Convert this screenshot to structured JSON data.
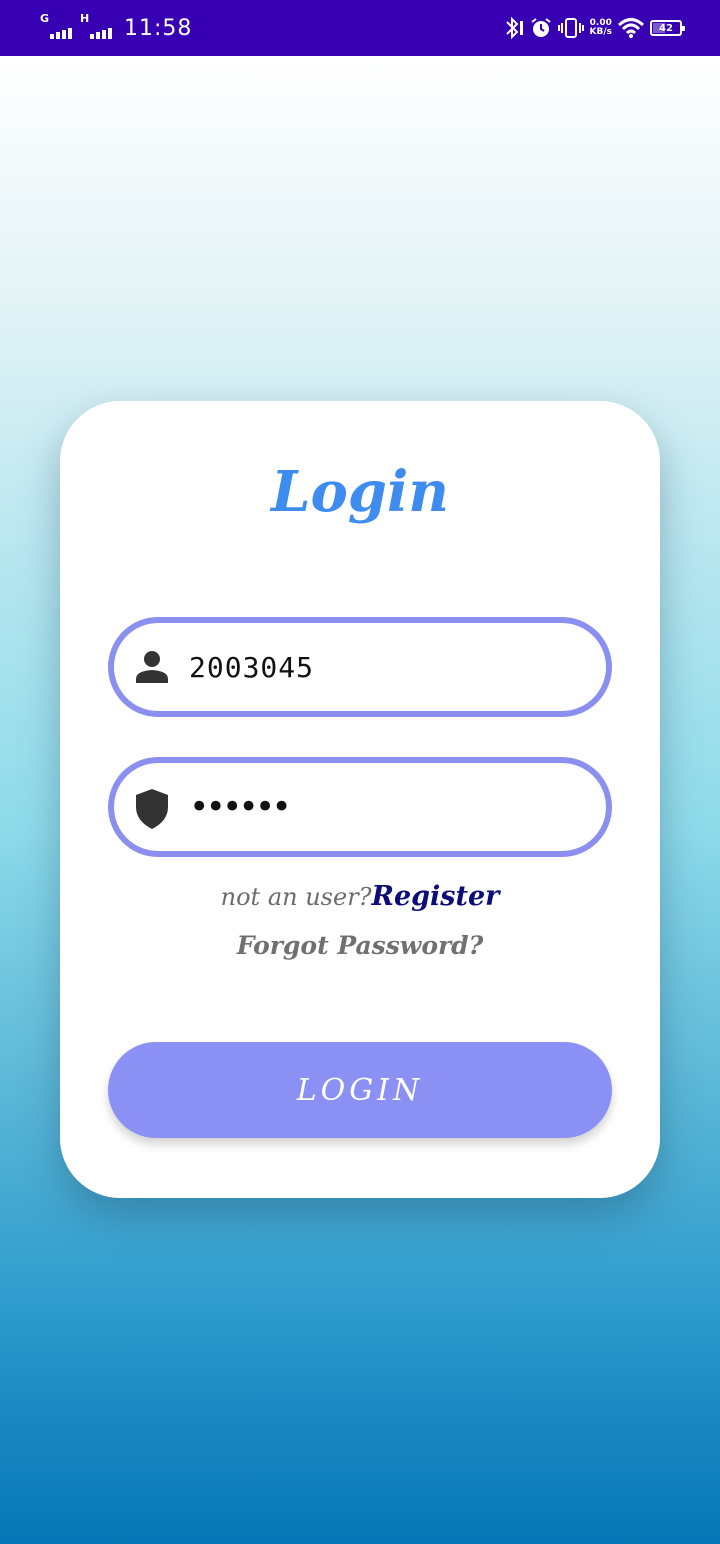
{
  "status_bar": {
    "sim1_label": "G",
    "sim2_label": "H",
    "time": "11:58",
    "net_speed_value": "0.00",
    "net_speed_unit": "KB/s",
    "battery_level": "42",
    "icons": [
      "bluetooth-icon",
      "alarm-icon",
      "vibrate-icon",
      "wifi-icon",
      "battery-icon"
    ]
  },
  "login_card": {
    "title": "Login",
    "username": {
      "value": "2003045",
      "icon": "person-icon"
    },
    "password": {
      "value": "aaaaaa",
      "icon": "shield-icon"
    },
    "prompt_text": "not an user?",
    "register_link": "Register",
    "forgot_link": "Forgot Password?",
    "login_button": "LOGIN"
  },
  "colors": {
    "status_bar": "#3700b3",
    "title": "#3f8cf0",
    "field_border": "#8a8ff0",
    "button": "#8a90f4",
    "register_link": "#0d0d7a"
  }
}
